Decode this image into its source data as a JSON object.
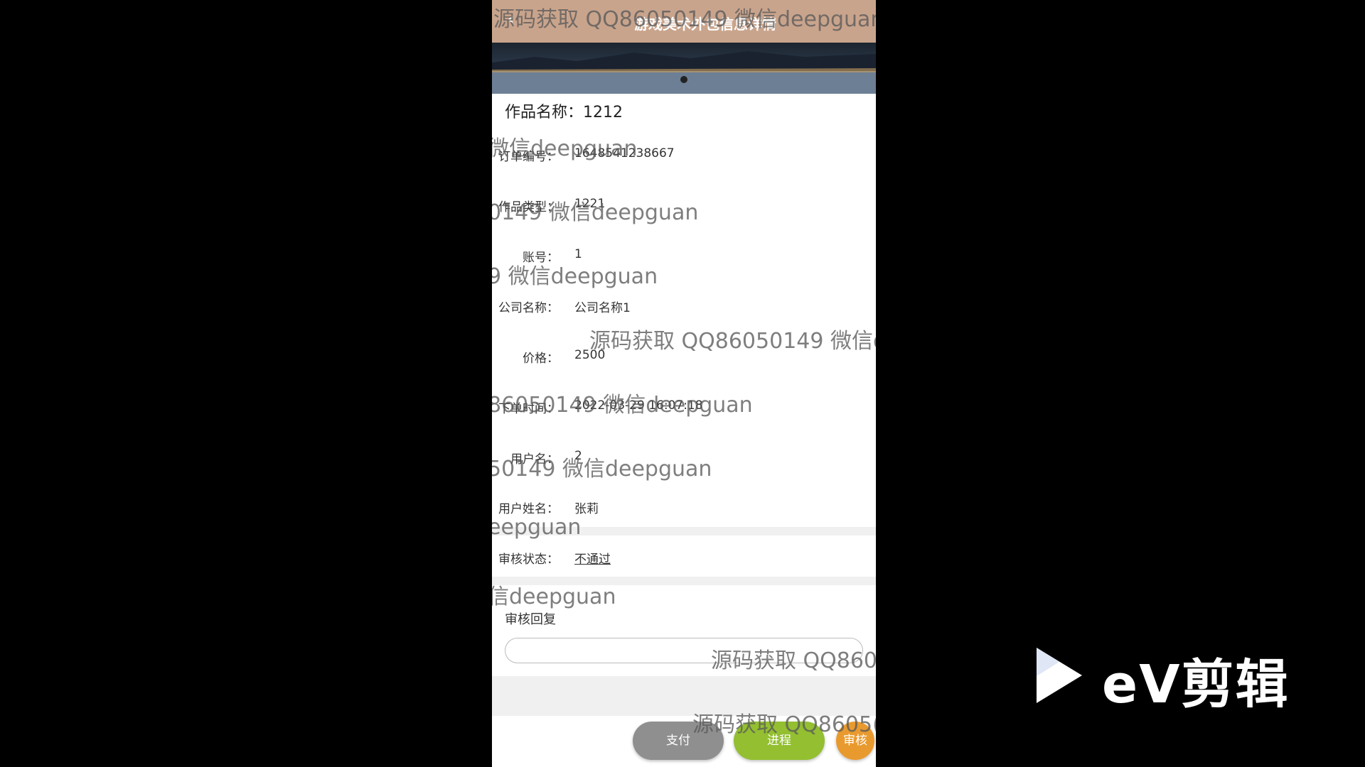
{
  "header": {
    "title": "游戏美术外包信息详情"
  },
  "work_title": {
    "label": "作品名称：",
    "value": "1212"
  },
  "fields": [
    {
      "label": "订单编号：",
      "value": "1648541238667"
    },
    {
      "label": "作品类型：",
      "value": "1221"
    },
    {
      "label": "账号：",
      "value": "1"
    },
    {
      "label": "公司名称：",
      "value": "公司名称1"
    },
    {
      "label": "价格：",
      "value": "2500"
    },
    {
      "label": "下单时间：",
      "value": "2022-03-29 16:07:18"
    },
    {
      "label": "用户名：",
      "value": "2"
    },
    {
      "label": "用户姓名：",
      "value": "张莉"
    }
  ],
  "review_status": {
    "label": "审核状态：",
    "value": "不通过"
  },
  "review_reply": {
    "label": "审核回复",
    "value": ""
  },
  "buttons": {
    "pay": "支付",
    "progress": "进程",
    "review": "审核"
  },
  "watermarks": [
    "源码获取 QQ86050149 微信deepguan",
    "微信deepguan",
    "0149 微信deepguan",
    "9 微信deepguan",
    "源码获取 QQ86050149 微信d",
    "86050149 微信deepguan",
    "50149 微信deepguan",
    "eepguan",
    "信deepguan",
    "源码获取 QQ860",
    "源码获取 QQ8605("
  ],
  "logo": {
    "text": "eV剪辑"
  }
}
